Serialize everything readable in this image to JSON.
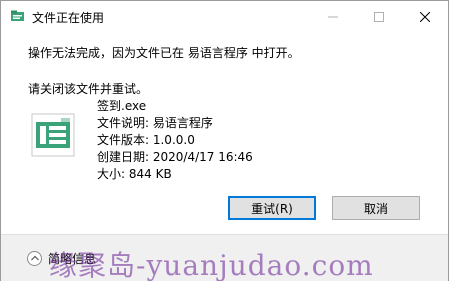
{
  "window": {
    "title": "文件正在使用",
    "app_icon": "folder-warning-icon",
    "controls": [
      "minimize-icon",
      "maximize-icon",
      "close-icon"
    ]
  },
  "message": "操作无法完成，因为文件已在 易语言程序 中打开。",
  "instruction": "请关闭该文件并重试。",
  "file": {
    "icon": "easy-language-program-icon",
    "name": "签到.exe",
    "description": "文件说明: 易语言程序",
    "version": "文件版本: 1.0.0.0",
    "created": "创建日期: 2020/4/17 16:46",
    "size": "大小: 844 KB"
  },
  "buttons": {
    "retry": "重试(R)",
    "cancel": "取消"
  },
  "footer": {
    "details_label": "简略信息",
    "watermark": "缘聚岛-yuanjudao.com"
  },
  "colors": {
    "accent": "#0078d7",
    "button_bg": "#e1e1e1",
    "footer_bg": "#f0f0f0",
    "icon_green": "#3aa37a",
    "watermark": "#7837a0"
  }
}
